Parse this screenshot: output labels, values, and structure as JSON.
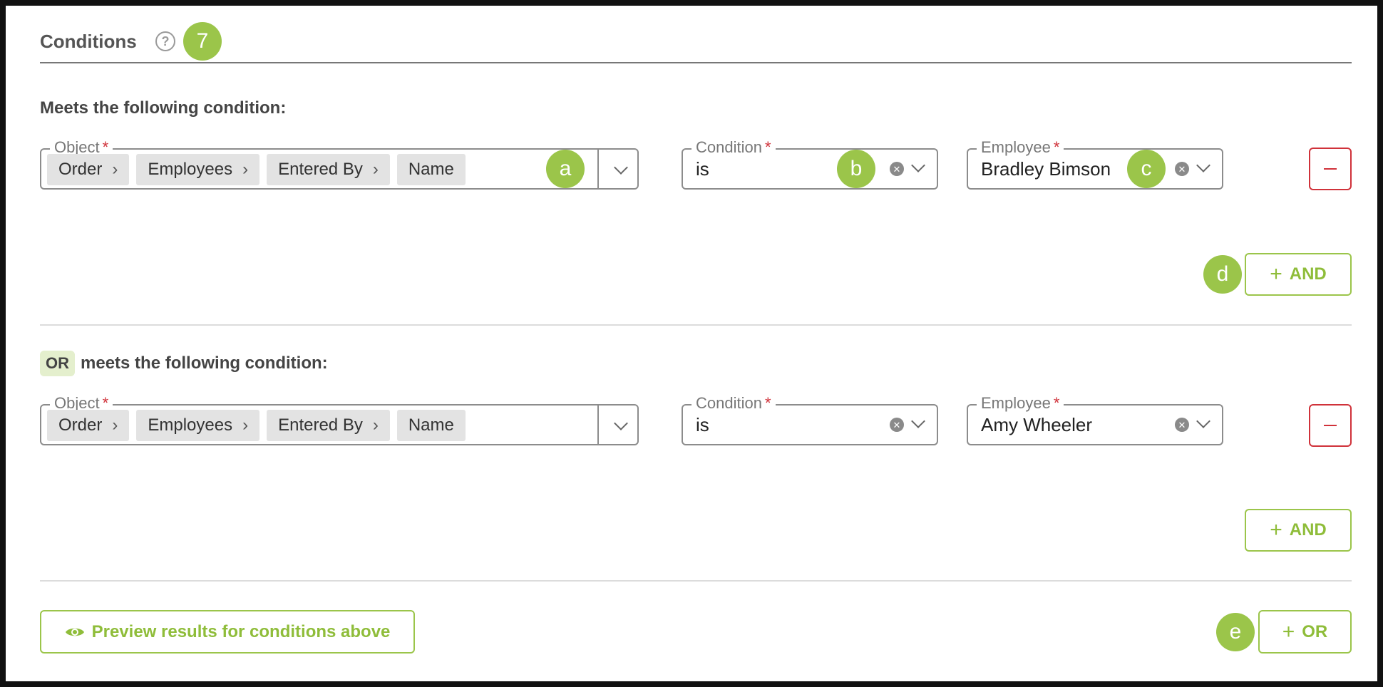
{
  "header": {
    "title": "Conditions",
    "help_icon": "?",
    "badge": "7"
  },
  "groups": [
    {
      "heading_prefix": "",
      "heading": "Meets the following condition:",
      "object_label": "Object",
      "object_path": [
        "Order",
        "Employees",
        "Entered By",
        "Name"
      ],
      "condition_label": "Condition",
      "condition_value": "is",
      "employee_label": "Employee",
      "employee_value": "Bradley Bimson",
      "and_label": "AND",
      "badges": {
        "object": "a",
        "condition": "b",
        "employee": "c",
        "and": "d"
      }
    },
    {
      "heading_prefix": "OR",
      "heading": "meets the following condition:",
      "object_label": "Object",
      "object_path": [
        "Order",
        "Employees",
        "Entered By",
        "Name"
      ],
      "condition_label": "Condition",
      "condition_value": "is",
      "employee_label": "Employee",
      "employee_value": "Amy Wheeler",
      "and_label": "AND"
    }
  ],
  "required_marker": "*",
  "preview_label": "Preview results for conditions above",
  "or_button_label": "OR",
  "or_badge": "e",
  "colors": {
    "accent": "#9bc54a",
    "danger": "#d0323a",
    "or_tag_bg": "#e4efcd"
  },
  "icons": {
    "help": "question-circle-icon",
    "chevron": "chevron-down-icon",
    "clear": "clear-circle-icon",
    "remove": "minus-icon",
    "add": "plus-icon",
    "preview": "eye-icon"
  }
}
